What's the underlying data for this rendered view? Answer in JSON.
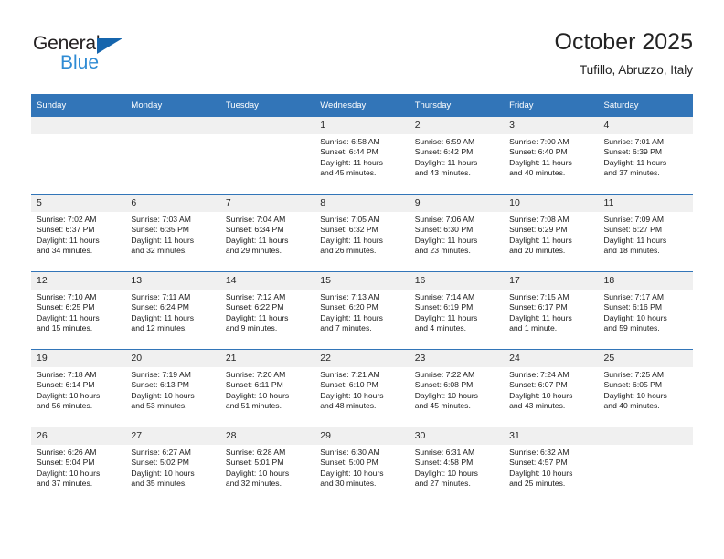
{
  "brand": {
    "name_top": "General",
    "name_bottom": "Blue",
    "triangle_color": "#1565ad",
    "blue_text_color": "#2e8bd4"
  },
  "header": {
    "title": "October 2025",
    "subtitle": "Tufillo, Abruzzo, Italy"
  },
  "theme": {
    "header_blue": "#3275b8",
    "daynum_band": "#f0f0f0",
    "text": "#1a1a1a"
  },
  "weekdays": [
    "Sunday",
    "Monday",
    "Tuesday",
    "Wednesday",
    "Thursday",
    "Friday",
    "Saturday"
  ],
  "labels": {
    "sunrise": "Sunrise:",
    "sunset": "Sunset:",
    "daylight": "Daylight:"
  },
  "weeks": [
    [
      {
        "day": "",
        "sunrise": "",
        "sunset": "",
        "daylight_line1": "",
        "daylight_line2": "",
        "blank": true
      },
      {
        "day": "",
        "sunrise": "",
        "sunset": "",
        "daylight_line1": "",
        "daylight_line2": "",
        "blank": true
      },
      {
        "day": "",
        "sunrise": "",
        "sunset": "",
        "daylight_line1": "",
        "daylight_line2": "",
        "blank": true
      },
      {
        "day": "1",
        "sunrise": "Sunrise: 6:58 AM",
        "sunset": "Sunset: 6:44 PM",
        "daylight_line1": "Daylight: 11 hours",
        "daylight_line2": "and 45 minutes.",
        "blank": false
      },
      {
        "day": "2",
        "sunrise": "Sunrise: 6:59 AM",
        "sunset": "Sunset: 6:42 PM",
        "daylight_line1": "Daylight: 11 hours",
        "daylight_line2": "and 43 minutes.",
        "blank": false
      },
      {
        "day": "3",
        "sunrise": "Sunrise: 7:00 AM",
        "sunset": "Sunset: 6:40 PM",
        "daylight_line1": "Daylight: 11 hours",
        "daylight_line2": "and 40 minutes.",
        "blank": false
      },
      {
        "day": "4",
        "sunrise": "Sunrise: 7:01 AM",
        "sunset": "Sunset: 6:39 PM",
        "daylight_line1": "Daylight: 11 hours",
        "daylight_line2": "and 37 minutes.",
        "blank": false
      }
    ],
    [
      {
        "day": "5",
        "sunrise": "Sunrise: 7:02 AM",
        "sunset": "Sunset: 6:37 PM",
        "daylight_line1": "Daylight: 11 hours",
        "daylight_line2": "and 34 minutes.",
        "blank": false
      },
      {
        "day": "6",
        "sunrise": "Sunrise: 7:03 AM",
        "sunset": "Sunset: 6:35 PM",
        "daylight_line1": "Daylight: 11 hours",
        "daylight_line2": "and 32 minutes.",
        "blank": false
      },
      {
        "day": "7",
        "sunrise": "Sunrise: 7:04 AM",
        "sunset": "Sunset: 6:34 PM",
        "daylight_line1": "Daylight: 11 hours",
        "daylight_line2": "and 29 minutes.",
        "blank": false
      },
      {
        "day": "8",
        "sunrise": "Sunrise: 7:05 AM",
        "sunset": "Sunset: 6:32 PM",
        "daylight_line1": "Daylight: 11 hours",
        "daylight_line2": "and 26 minutes.",
        "blank": false
      },
      {
        "day": "9",
        "sunrise": "Sunrise: 7:06 AM",
        "sunset": "Sunset: 6:30 PM",
        "daylight_line1": "Daylight: 11 hours",
        "daylight_line2": "and 23 minutes.",
        "blank": false
      },
      {
        "day": "10",
        "sunrise": "Sunrise: 7:08 AM",
        "sunset": "Sunset: 6:29 PM",
        "daylight_line1": "Daylight: 11 hours",
        "daylight_line2": "and 20 minutes.",
        "blank": false
      },
      {
        "day": "11",
        "sunrise": "Sunrise: 7:09 AM",
        "sunset": "Sunset: 6:27 PM",
        "daylight_line1": "Daylight: 11 hours",
        "daylight_line2": "and 18 minutes.",
        "blank": false
      }
    ],
    [
      {
        "day": "12",
        "sunrise": "Sunrise: 7:10 AM",
        "sunset": "Sunset: 6:25 PM",
        "daylight_line1": "Daylight: 11 hours",
        "daylight_line2": "and 15 minutes.",
        "blank": false
      },
      {
        "day": "13",
        "sunrise": "Sunrise: 7:11 AM",
        "sunset": "Sunset: 6:24 PM",
        "daylight_line1": "Daylight: 11 hours",
        "daylight_line2": "and 12 minutes.",
        "blank": false
      },
      {
        "day": "14",
        "sunrise": "Sunrise: 7:12 AM",
        "sunset": "Sunset: 6:22 PM",
        "daylight_line1": "Daylight: 11 hours",
        "daylight_line2": "and 9 minutes.",
        "blank": false
      },
      {
        "day": "15",
        "sunrise": "Sunrise: 7:13 AM",
        "sunset": "Sunset: 6:20 PM",
        "daylight_line1": "Daylight: 11 hours",
        "daylight_line2": "and 7 minutes.",
        "blank": false
      },
      {
        "day": "16",
        "sunrise": "Sunrise: 7:14 AM",
        "sunset": "Sunset: 6:19 PM",
        "daylight_line1": "Daylight: 11 hours",
        "daylight_line2": "and 4 minutes.",
        "blank": false
      },
      {
        "day": "17",
        "sunrise": "Sunrise: 7:15 AM",
        "sunset": "Sunset: 6:17 PM",
        "daylight_line1": "Daylight: 11 hours",
        "daylight_line2": "and 1 minute.",
        "blank": false
      },
      {
        "day": "18",
        "sunrise": "Sunrise: 7:17 AM",
        "sunset": "Sunset: 6:16 PM",
        "daylight_line1": "Daylight: 10 hours",
        "daylight_line2": "and 59 minutes.",
        "blank": false
      }
    ],
    [
      {
        "day": "19",
        "sunrise": "Sunrise: 7:18 AM",
        "sunset": "Sunset: 6:14 PM",
        "daylight_line1": "Daylight: 10 hours",
        "daylight_line2": "and 56 minutes.",
        "blank": false
      },
      {
        "day": "20",
        "sunrise": "Sunrise: 7:19 AM",
        "sunset": "Sunset: 6:13 PM",
        "daylight_line1": "Daylight: 10 hours",
        "daylight_line2": "and 53 minutes.",
        "blank": false
      },
      {
        "day": "21",
        "sunrise": "Sunrise: 7:20 AM",
        "sunset": "Sunset: 6:11 PM",
        "daylight_line1": "Daylight: 10 hours",
        "daylight_line2": "and 51 minutes.",
        "blank": false
      },
      {
        "day": "22",
        "sunrise": "Sunrise: 7:21 AM",
        "sunset": "Sunset: 6:10 PM",
        "daylight_line1": "Daylight: 10 hours",
        "daylight_line2": "and 48 minutes.",
        "blank": false
      },
      {
        "day": "23",
        "sunrise": "Sunrise: 7:22 AM",
        "sunset": "Sunset: 6:08 PM",
        "daylight_line1": "Daylight: 10 hours",
        "daylight_line2": "and 45 minutes.",
        "blank": false
      },
      {
        "day": "24",
        "sunrise": "Sunrise: 7:24 AM",
        "sunset": "Sunset: 6:07 PM",
        "daylight_line1": "Daylight: 10 hours",
        "daylight_line2": "and 43 minutes.",
        "blank": false
      },
      {
        "day": "25",
        "sunrise": "Sunrise: 7:25 AM",
        "sunset": "Sunset: 6:05 PM",
        "daylight_line1": "Daylight: 10 hours",
        "daylight_line2": "and 40 minutes.",
        "blank": false
      }
    ],
    [
      {
        "day": "26",
        "sunrise": "Sunrise: 6:26 AM",
        "sunset": "Sunset: 5:04 PM",
        "daylight_line1": "Daylight: 10 hours",
        "daylight_line2": "and 37 minutes.",
        "blank": false
      },
      {
        "day": "27",
        "sunrise": "Sunrise: 6:27 AM",
        "sunset": "Sunset: 5:02 PM",
        "daylight_line1": "Daylight: 10 hours",
        "daylight_line2": "and 35 minutes.",
        "blank": false
      },
      {
        "day": "28",
        "sunrise": "Sunrise: 6:28 AM",
        "sunset": "Sunset: 5:01 PM",
        "daylight_line1": "Daylight: 10 hours",
        "daylight_line2": "and 32 minutes.",
        "blank": false
      },
      {
        "day": "29",
        "sunrise": "Sunrise: 6:30 AM",
        "sunset": "Sunset: 5:00 PM",
        "daylight_line1": "Daylight: 10 hours",
        "daylight_line2": "and 30 minutes.",
        "blank": false
      },
      {
        "day": "30",
        "sunrise": "Sunrise: 6:31 AM",
        "sunset": "Sunset: 4:58 PM",
        "daylight_line1": "Daylight: 10 hours",
        "daylight_line2": "and 27 minutes.",
        "blank": false
      },
      {
        "day": "31",
        "sunrise": "Sunrise: 6:32 AM",
        "sunset": "Sunset: 4:57 PM",
        "daylight_line1": "Daylight: 10 hours",
        "daylight_line2": "and 25 minutes.",
        "blank": false
      },
      {
        "day": "",
        "sunrise": "",
        "sunset": "",
        "daylight_line1": "",
        "daylight_line2": "",
        "blank": true
      }
    ]
  ]
}
